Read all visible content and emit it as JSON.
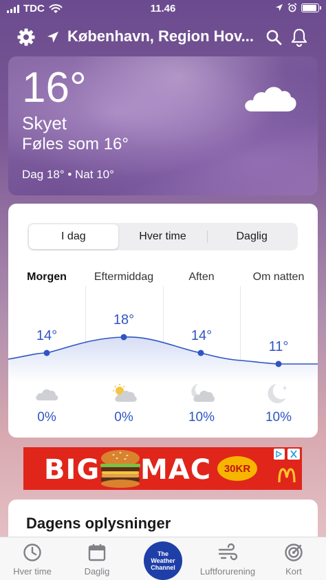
{
  "status_bar": {
    "carrier": "TDC",
    "time": "11.46"
  },
  "header": {
    "location": "København, Region Hov..."
  },
  "current": {
    "temperature": "16°",
    "condition": "Skyet",
    "feels_like": "Føles som 16°",
    "day_night": "Dag 18° • Nat 10°"
  },
  "forecast": {
    "tabs": [
      "I dag",
      "Hver time",
      "Daglig"
    ],
    "active_tab": "I dag",
    "periods": [
      {
        "label": "Morgen",
        "temp": "14°",
        "precip": "0%",
        "icon": "cloud-icon"
      },
      {
        "label": "Eftermiddag",
        "temp": "18°",
        "precip": "0%",
        "icon": "partly-sunny-icon"
      },
      {
        "label": "Aften",
        "temp": "14°",
        "precip": "10%",
        "icon": "cloudy-moon-icon"
      },
      {
        "label": "Om natten",
        "temp": "11°",
        "precip": "10%",
        "icon": "clear-night-icon"
      }
    ],
    "accent_color": "#2e55c2"
  },
  "ad": {
    "left_text": "BIG",
    "right_text": "MAC",
    "price": "30KR"
  },
  "details": {
    "title": "Dagens oplysninger"
  },
  "tab_bar": {
    "items": [
      "Hver time",
      "Daglig",
      "Luftforurening",
      "Kort"
    ],
    "logo_text": [
      "The",
      "Weather",
      "Channel"
    ]
  }
}
